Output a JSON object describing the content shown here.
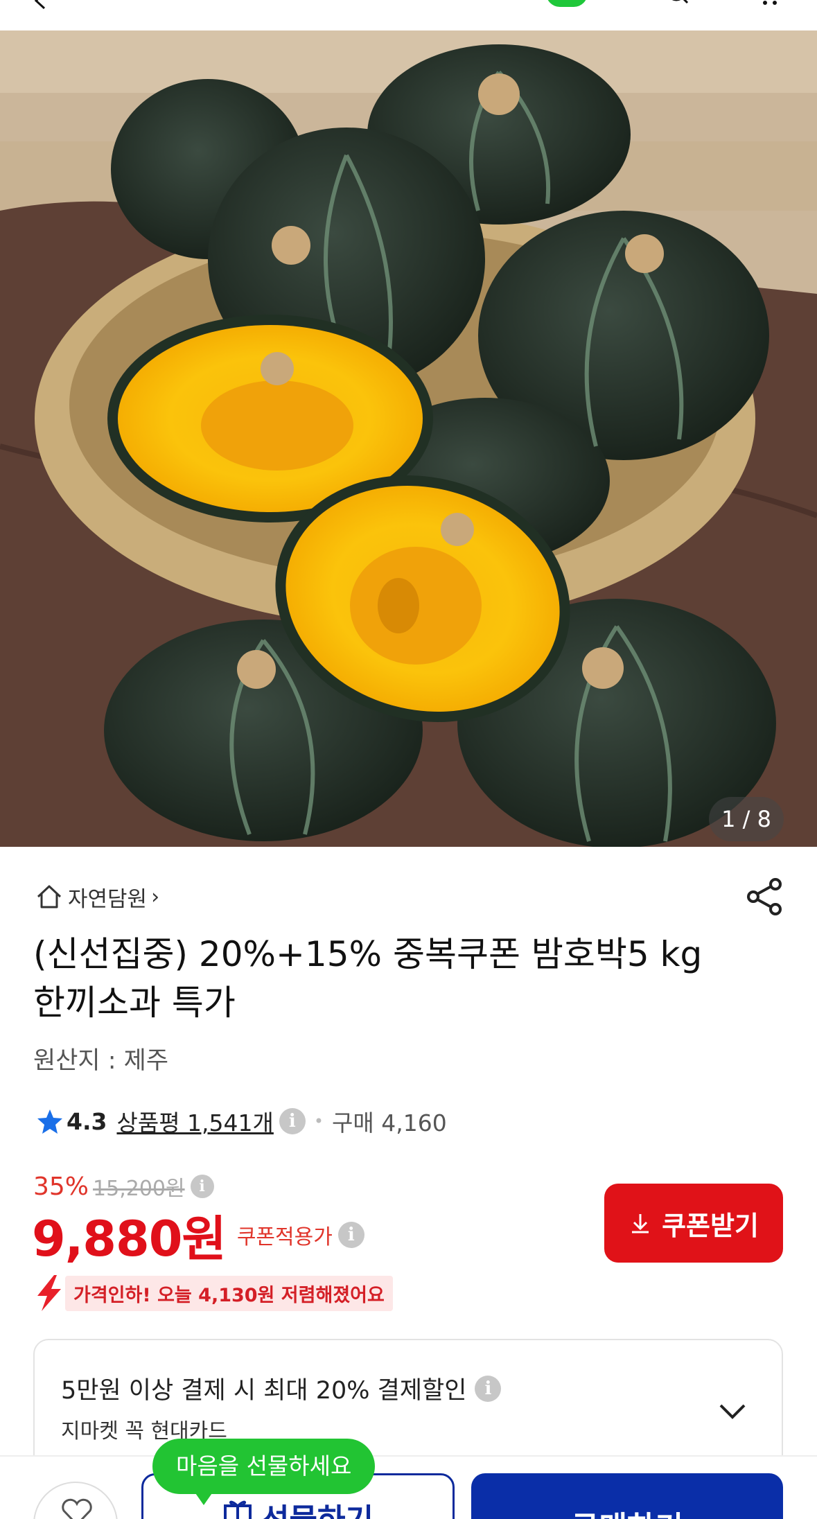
{
  "gallery": {
    "counter": "1 / 8"
  },
  "store": {
    "name": "자연담원"
  },
  "product": {
    "title": "(신선집중) 20%+15% 중복쿠폰 밤호박5 kg 한끼소과 특가",
    "origin": "원산지 : 제주"
  },
  "rating": {
    "score": "4.3",
    "reviews": "상품평 1,541개",
    "purchases": "구매 4,160"
  },
  "price": {
    "discount_pct": "35%",
    "original": "15,200원",
    "sale": "9,880원",
    "coupon_label": "쿠폰적용가",
    "coupon_button": "쿠폰받기",
    "price_drop": "가격인하! 오늘 4,130원 저렴해졌어요"
  },
  "promo": {
    "main": "5만원 이상 결제 시 최대 20% 결제할인",
    "sub": "지마켓 꼭 현대카드"
  },
  "bottom": {
    "tooltip": "마음을 선물하세요",
    "gift_label": "선물하기",
    "buy_label": "구매하기"
  },
  "colors": {
    "accent_red": "#e0101a",
    "brand_blue": "#0a2ea8",
    "tooltip_green": "#22c433"
  }
}
